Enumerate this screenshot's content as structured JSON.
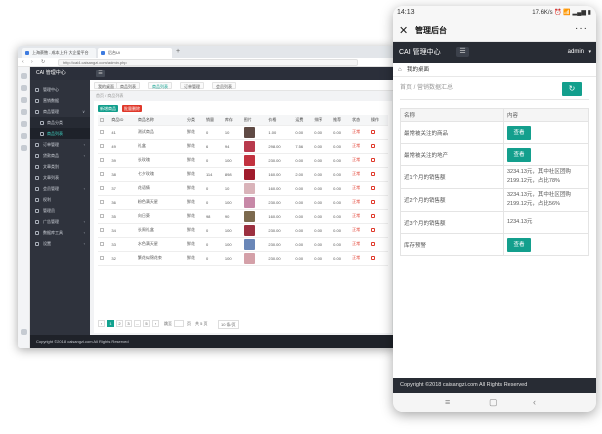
{
  "browser": {
    "tabs": [
      "上海蔡鲍 - 成本上升 大企爱平台",
      "后台Ui"
    ],
    "new_tab": "+",
    "url": "http://cai4.caisangzi.com/admin.php",
    "nav_back": "‹",
    "nav_forward": "›",
    "nav_reload": "↻"
  },
  "desktop": {
    "brand": "CAI 管理中心",
    "menu_icon": "☰",
    "sidebar": [
      {
        "label": "管理中心",
        "icon": "home-icon"
      },
      {
        "label": "营销数据",
        "icon": "chart-icon"
      },
      {
        "label": "商品管理",
        "icon": "box-icon",
        "arrow": "∨"
      },
      {
        "label": "商品分类",
        "icon": "list-icon",
        "sub": true
      },
      {
        "label": "商品列表",
        "icon": "list-icon",
        "sub": true,
        "active": true
      },
      {
        "label": "订单管理",
        "icon": "order-icon",
        "arrow": "‹"
      },
      {
        "label": "贷款商品",
        "icon": "money-icon",
        "arrow": "‹"
      },
      {
        "label": "文章类别",
        "icon": "doc-icon"
      },
      {
        "label": "文章列表",
        "icon": "doc-icon"
      },
      {
        "label": "会员管理",
        "icon": "user-icon",
        "arrow": "‹"
      },
      {
        "label": "权利",
        "icon": "key-icon"
      },
      {
        "label": "管理员",
        "icon": "admin-icon"
      },
      {
        "label": "广告管理",
        "icon": "ad-icon",
        "arrow": "‹"
      },
      {
        "label": "数据库工具",
        "icon": "db-icon",
        "arrow": "‹"
      },
      {
        "label": "设置",
        "icon": "gear-icon",
        "arrow": "‹"
      }
    ],
    "content_tabs": [
      "我的桌面",
      "商品列表",
      "商品列表",
      "订单管理",
      "会员列表"
    ],
    "breadcrumb": "首页  /  商品列表",
    "add_button": "新增商品",
    "delete_button": "批量删除",
    "table_headers": [
      "",
      "商品ID",
      "商品名称",
      "分类",
      "销量",
      "库存",
      "图片",
      "价格",
      "运费",
      "排序",
      "推荐",
      "状态",
      "操作"
    ],
    "rows": [
      {
        "id": "41",
        "name": "测试商品",
        "cat": "鲜花",
        "sales": "0",
        "stock": "10",
        "price": "1.00",
        "ship": "0.00",
        "sort": "0.00",
        "rec": "0.00",
        "status": "正常",
        "thumb": "#5f4a44"
      },
      {
        "id": "49",
        "name": "礼盒",
        "cat": "鲜花",
        "sales": "6",
        "stock": "94",
        "price": "298.00",
        "ship": "7.56",
        "sort": "0.00",
        "rec": "0.00",
        "status": "正常",
        "thumb": "#b83a4d"
      },
      {
        "id": "39",
        "name": "长玫瑰",
        "cat": "鲜花",
        "sales": "0",
        "stock": "100",
        "price": "230.00",
        "ship": "0.00",
        "sort": "0.00",
        "rec": "0.00",
        "status": "正常",
        "thumb": "#c2323f"
      },
      {
        "id": "38",
        "name": "七夕玫瑰",
        "cat": "鲜花",
        "sales": "114",
        "stock": "898",
        "price": "160.00",
        "ship": "2.00",
        "sort": "0.00",
        "rec": "0.00",
        "status": "正常",
        "thumb": "#a01b2c"
      },
      {
        "id": "37",
        "name": "花语情",
        "cat": "鲜花",
        "sales": "0",
        "stock": "10",
        "price": "160.00",
        "ship": "0.00",
        "sort": "0.00",
        "rec": "0.00",
        "status": "正常",
        "thumb": "#d9b3b9"
      },
      {
        "id": "36",
        "name": "粉色满天星",
        "cat": "鲜花",
        "sales": "0",
        "stock": "100",
        "price": "230.00",
        "ship": "0.00",
        "sort": "0.00",
        "rec": "0.00",
        "status": "正常",
        "thumb": "#c788a7"
      },
      {
        "id": "35",
        "name": "向日葵",
        "cat": "鲜花",
        "sales": "98",
        "stock": "90",
        "price": "160.00",
        "ship": "0.00",
        "sort": "0.00",
        "rec": "0.00",
        "status": "正常",
        "thumb": "#7c6a4e"
      },
      {
        "id": "34",
        "name": "长周礼盒",
        "cat": "鲜花",
        "sales": "0",
        "stock": "100",
        "price": "230.00",
        "ship": "0.00",
        "sort": "0.00",
        "rec": "0.00",
        "status": "正常",
        "thumb": "#9c3040"
      },
      {
        "id": "33",
        "name": "水色满天星",
        "cat": "鲜花",
        "sales": "0",
        "stock": "100",
        "price": "230.00",
        "ship": "0.00",
        "sort": "0.00",
        "rec": "0.00",
        "status": "正常",
        "thumb": "#6a87b8"
      },
      {
        "id": "32",
        "name": "繁花似锦花束",
        "cat": "鲜花",
        "sales": "0",
        "stock": "100",
        "price": "230.00",
        "ship": "0.00",
        "sort": "0.00",
        "rec": "0.00",
        "status": "正常",
        "thumb": "#d4a0a8"
      }
    ],
    "pager": {
      "prev": "‹",
      "pages": [
        "1",
        "2",
        "3",
        "...",
        "5"
      ],
      "next": "›",
      "goto": "跳至",
      "page_unit": "页",
      "total": "共 5 页",
      "per_page": "10 条/页"
    },
    "copyright": "Copyright ©2018 caisangzi.com All Rights Reserved"
  },
  "phone": {
    "status_time": "14:13",
    "status_right": "17.6K/s ⏰ 📶 ▂▄▆ ▮",
    "title": "管理后台",
    "close": "✕",
    "more": "···",
    "brand": "CAI 管理中心",
    "menu_icon": "☰",
    "user": "admin",
    "caret": "▾",
    "desk_icon": "⌂",
    "desk_label": "我的桌面",
    "breadcrumb": "首页  /  营销数据汇总",
    "refresh": "↻",
    "table_headers": [
      "名称",
      "内容"
    ],
    "rows": [
      {
        "name": "最常被关注的商品",
        "button": "查看"
      },
      {
        "name": "最常被关注的地产",
        "button": "查看"
      },
      {
        "name": "近1个月的销售额",
        "value": "3234.13元，其中社区团购2199.12元，占比78%"
      },
      {
        "name": "近2个月的销售额",
        "value": "3234.13元，其中社区团购2199.12元，占比56%"
      },
      {
        "name": "近3个月的销售额",
        "value": "1234.13元"
      },
      {
        "name": "库存预警",
        "button": "查看"
      }
    ],
    "footer": "Copyright ©2018 caisangzi.com All Rights Reserved",
    "nav": [
      "≡",
      "▢",
      "‹"
    ]
  },
  "colors": {
    "accent": "#139f8d",
    "dark": "#282c34",
    "danger": "#e0382a"
  }
}
